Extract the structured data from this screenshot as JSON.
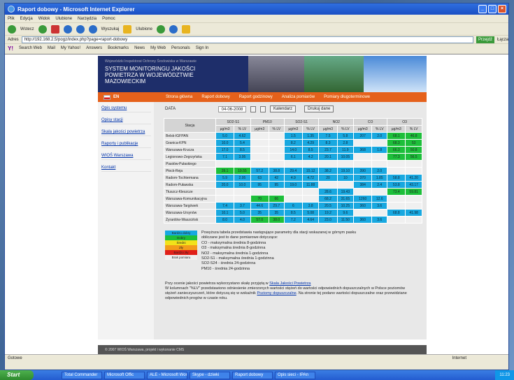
{
  "window": {
    "title": "Raport dobowy - Microsoft Internet Explorer"
  },
  "menu": [
    "Plik",
    "Edycja",
    "Widok",
    "Ulubione",
    "Narzędzia",
    "Pomoc"
  ],
  "toolbar": {
    "back": "Wstecz",
    "search": "Wyszukaj",
    "favorites": "Ulubione"
  },
  "address": {
    "label": "Adres",
    "url": "http://192.168.2.5/pogz/index.php?page=raport-dobowy",
    "go": "Przejdź",
    "links": "Łącza"
  },
  "yahoo": {
    "logo": "Y!",
    "items": [
      "Search Web",
      "Mail",
      "My Yahoo!",
      "Answers",
      "Bookmarks",
      "News",
      "My Web",
      "Personals",
      "Sign In"
    ]
  },
  "banner": {
    "line1": "Wojewódzki Inspektorat Ochrony Środowiska w Warszawie",
    "line2": "SYSTEM MONITORINGU JAKOŚCI POWIETRZA W WOJEWÓDZTWIE MAZOWIECKIM"
  },
  "nav": {
    "lang": "EN",
    "items": [
      "Strona główna",
      "Raport dobowy",
      "Raport godzinowy",
      "Analiza pomiarów",
      "Pomiary długoterminowe"
    ]
  },
  "sidebar": [
    "Opis systemu",
    "Opisy stacji",
    "Skala jakości powietrza",
    "Raporty i publikacje",
    "WIOŚ Warszawa",
    "Kontakt"
  ],
  "form": {
    "date_label": "DATA",
    "date_value": "04-06-2008",
    "calendar_btn": "Kalendarz",
    "print_btn": "Drukuj dane"
  },
  "table": {
    "station_header": "Stacja",
    "pollutants": [
      "SO2-S1",
      "PM10",
      "SO2-S1",
      "NO2",
      "CO",
      "O3"
    ],
    "subheaders": [
      "µg/m3",
      "% LV"
    ],
    "rows": [
      {
        "name": "Belsk-IGFPAN",
        "cells": [
          [
            "b",
            "5.0"
          ],
          [
            "b",
            "4.62"
          ],
          [
            "",
            ""
          ],
          [
            "",
            ""
          ],
          [
            "b",
            "1.5"
          ],
          [
            "b",
            "1.35"
          ],
          [
            "b",
            "7.5"
          ],
          [
            "b",
            "5.8"
          ],
          [
            "b",
            "207"
          ],
          [
            "b",
            "2.0"
          ],
          [
            "g",
            "68.1"
          ],
          [
            "g",
            "46.8"
          ]
        ]
      },
      {
        "name": "Granica-KPN",
        "cells": [
          [
            "b",
            "10.0"
          ],
          [
            "b",
            "5.4"
          ],
          [
            "",
            ""
          ],
          [
            "",
            ""
          ],
          [
            "b",
            "8.2"
          ],
          [
            "b",
            "4.29"
          ],
          [
            "b",
            "8.3"
          ],
          [
            "b",
            "2.8"
          ],
          [
            "",
            ""
          ],
          [
            "",
            ""
          ],
          [
            "g",
            "68.3"
          ],
          [
            "g",
            "53"
          ]
        ]
      },
      {
        "name": "Warszawa-Krucza",
        "cells": [
          [
            "b",
            "17.0"
          ],
          [
            "b",
            "8.5"
          ],
          [
            "",
            ""
          ],
          [
            "",
            ""
          ],
          [
            "b",
            "14.0"
          ],
          [
            "b",
            "8.5"
          ],
          [
            "b",
            "23.7"
          ],
          [
            "b",
            "11.9"
          ],
          [
            "b",
            "368"
          ],
          [
            "b",
            "1.8"
          ],
          [
            "g",
            "66.3"
          ],
          [
            "g",
            "50.8"
          ]
        ]
      },
      {
        "name": "Legionowo-Zegrzyńska",
        "cells": [
          [
            "b",
            "7.1"
          ],
          [
            "b",
            "3.95"
          ],
          [
            "",
            ""
          ],
          [
            "",
            ""
          ],
          [
            "b",
            "6.1"
          ],
          [
            "b",
            "4.2"
          ],
          [
            "b",
            "20.1"
          ],
          [
            "b",
            "10.05"
          ],
          [
            "",
            ""
          ],
          [
            "",
            ""
          ],
          [
            "g",
            "77.3"
          ],
          [
            "g",
            "56.5"
          ]
        ]
      },
      {
        "name": "Piastów-Pułaskiego",
        "cells": [
          [
            "",
            ""
          ],
          [
            "",
            ""
          ],
          [
            "",
            ""
          ],
          [
            "",
            ""
          ],
          [
            "",
            ""
          ],
          [
            "",
            ""
          ],
          [
            "",
            ""
          ],
          [
            "",
            ""
          ],
          [
            "",
            ""
          ],
          [
            "",
            ""
          ],
          [
            "",
            ""
          ],
          [
            "",
            ""
          ]
        ]
      },
      {
        "name": "Płock-Reja",
        "cells": [
          [
            "g",
            "39.1"
          ],
          [
            "g",
            "19.55"
          ],
          [
            "b",
            "57.2"
          ],
          [
            "b",
            "38.8"
          ],
          [
            "b",
            "29.4"
          ],
          [
            "b",
            "15.12"
          ],
          [
            "b",
            "38.2"
          ],
          [
            "b",
            "19.10"
          ],
          [
            "b",
            "390"
          ],
          [
            "b",
            "2.0"
          ],
          [
            "",
            ""
          ],
          [
            "",
            ""
          ]
        ]
      },
      {
        "name": "Radom-Tochtermana",
        "cells": [
          [
            "b",
            "5.9"
          ],
          [
            "b",
            "2.95"
          ],
          [
            "b",
            "63"
          ],
          [
            "b",
            "42"
          ],
          [
            "b",
            "4.9"
          ],
          [
            "b",
            "4.72"
          ],
          [
            "b",
            "20"
          ],
          [
            "b",
            "10"
          ],
          [
            "b",
            "370"
          ],
          [
            "b",
            "1.85"
          ],
          [
            "b",
            "58.8"
          ],
          [
            "b",
            "41.20"
          ]
        ]
      },
      {
        "name": "Radom-Puławska",
        "cells": [
          [
            "b",
            "20.0"
          ],
          [
            "b",
            "10.0"
          ],
          [
            "b",
            "95"
          ],
          [
            "b",
            "95"
          ],
          [
            "b",
            "19.0"
          ],
          [
            "b",
            "11.88"
          ],
          [
            "",
            ""
          ],
          [
            "",
            ""
          ],
          [
            "b",
            "384"
          ],
          [
            "b",
            "2.4"
          ],
          [
            "b",
            "53.8"
          ],
          [
            "b",
            "43.17"
          ]
        ]
      },
      {
        "name": "Tłuszcz-Kleszcze",
        "cells": [
          [
            "",
            ""
          ],
          [
            "",
            ""
          ],
          [
            "",
            ""
          ],
          [
            "",
            ""
          ],
          [
            "",
            ""
          ],
          [
            "",
            ""
          ],
          [
            "b",
            "28.6"
          ],
          [
            "b",
            "19.43"
          ],
          [
            "",
            ""
          ],
          [
            "",
            ""
          ],
          [
            "g",
            "73.4"
          ],
          [
            "g",
            "59.81"
          ]
        ]
      },
      {
        "name": "Warszawa-Komunikacyjna",
        "cells": [
          [
            "",
            ""
          ],
          [
            "",
            ""
          ],
          [
            "g",
            "70"
          ],
          [
            "g",
            "66"
          ],
          [
            "",
            ""
          ],
          [
            "",
            ""
          ],
          [
            "b",
            "68.2"
          ],
          [
            "b",
            "31.65"
          ],
          [
            "b",
            "1260"
          ],
          [
            "b",
            "12.6"
          ],
          [
            "",
            ""
          ],
          [
            "",
            ""
          ]
        ]
      },
      {
        "name": "Warszawa-Targówek",
        "cells": [
          [
            "b",
            "7.4"
          ],
          [
            "b",
            "3.7"
          ],
          [
            "b",
            "44.6"
          ],
          [
            "b",
            "29.7"
          ],
          [
            "b",
            "6"
          ],
          [
            "b",
            "3.8"
          ],
          [
            "b",
            "20.5"
          ],
          [
            "b",
            "10.25"
          ],
          [
            "b",
            "360"
          ],
          [
            "b",
            "3.6"
          ],
          [
            "",
            ""
          ],
          [
            "",
            ""
          ]
        ]
      },
      {
        "name": "Warszawa-Ursynów",
        "cells": [
          [
            "b",
            "10.1"
          ],
          [
            "b",
            "5.0"
          ],
          [
            "b",
            "35"
          ],
          [
            "b",
            "35"
          ],
          [
            "b",
            "8.5"
          ],
          [
            "b",
            "5.08"
          ],
          [
            "b",
            "19.2"
          ],
          [
            "b",
            "9.6"
          ],
          [
            "",
            ""
          ],
          [
            "",
            ""
          ],
          [
            "b",
            "68.8"
          ],
          [
            "b",
            "41.98"
          ]
        ]
      },
      {
        "name": "Żyrardów-Waszcińsk",
        "cells": [
          [
            "b",
            "8.0"
          ],
          [
            "b",
            "4.0"
          ],
          [
            "g",
            "57.0"
          ],
          [
            "g",
            "38.0"
          ],
          [
            "b",
            "7.2"
          ],
          [
            "b",
            "4.64"
          ],
          [
            "b",
            "23.0"
          ],
          [
            "b",
            "11.50"
          ],
          [
            "b",
            "360"
          ],
          [
            "b",
            "3.6"
          ],
          [
            "",
            ""
          ],
          [
            "",
            ""
          ]
        ]
      }
    ]
  },
  "legend": {
    "labels": [
      "Bardzo dobry",
      "Dobry",
      "Średni",
      "Zły",
      "Bardzo zły",
      "Brak pomiaru"
    ],
    "colors": [
      "#18a8e0",
      "#1dbf3a",
      "#f2e21a",
      "#f39c1a",
      "#e0201a",
      "#f0f0f0"
    ],
    "lines": [
      "Powyższa tabela przedstawia następujące parametry dla stacji wskazanej w górnym pasku",
      "obliczane jest to dane pomiarowe dotyczące:",
      "CO - maksymalna średnia 8-godzinna",
      "O3 - maksymalna średnia 8-godzinna",
      "NO2 - maksymalna średnia 1-godzinna",
      "SO2-S1 - maksymalna średnia 1-godzinna",
      "SO2-S24 - średnia 24-godzinna",
      "PM10 - średnia 24-godzinna"
    ]
  },
  "note": {
    "line1_pre": "Przy ocenie jakości powietrza wykorzystano skalę przyjętą w ",
    "link1": "Skala Jakości Powietrza",
    "line2": "W kolumnach \"%LV\" przedstawiono odniesienie zmierzonych wartości stężeń do wartości odpowiednich dopuszczalnych w Polsce poziomów stężeń zanieczyszczeń, które dotyczą się w wskaźnik ",
    "link2": "Poziomy dopuszczalne",
    "line3": ". Na stronie tej podano wartości dopuszczalne oraz przewidziane odpowiednich progów w czasie roku."
  },
  "footer": "© 2007 WIOŚ Warszawa, projekt i wykonanie CMS",
  "status": {
    "left": "Gotowe",
    "zone": "Internet"
  },
  "taskbar": {
    "start": "Start",
    "tasks": [
      "Total Commander",
      "Microsoft Offic",
      "ALE - Microsoft Word",
      "Skype - dziwki",
      "Raport dobowy",
      "Opis sieci - IPAn"
    ],
    "clock": "11:23"
  }
}
